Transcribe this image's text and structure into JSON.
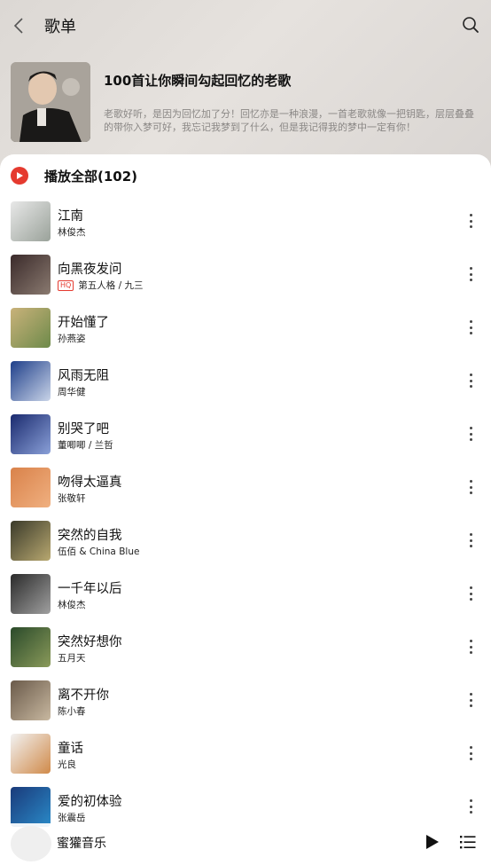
{
  "header": {
    "title": "歌单",
    "back_icon": "chevron-left-icon",
    "search_icon": "search-icon"
  },
  "playlist": {
    "name": "100首让你瞬间勾起回忆的老歌",
    "description": "老歌好听，是因为回忆加了分！回忆亦是一种浪漫，一首老歌就像一把钥匙，层层叠叠的带你入梦可好，我忘记我梦到了什么，但是我记得我的梦中一定有你！"
  },
  "play_all": {
    "label": "播放全部(102)",
    "icon": "play-circle-icon",
    "accent": "#e53a2f"
  },
  "songs": [
    {
      "title": "江南",
      "artist": "林俊杰",
      "hq": false,
      "cover": [
        "#e8e8e8",
        "#9aa29a"
      ]
    },
    {
      "title": "向黑夜发问",
      "artist": "第五人格 / 九三",
      "hq": true,
      "cover": [
        "#3a2a2a",
        "#8a7a70"
      ]
    },
    {
      "title": "开始懂了",
      "artist": "孙燕姿",
      "hq": false,
      "cover": [
        "#c9b27a",
        "#6e8a4a"
      ]
    },
    {
      "title": "风雨无阻",
      "artist": "周华健",
      "hq": false,
      "cover": [
        "#1f3f8a",
        "#c9d4e8"
      ]
    },
    {
      "title": "别哭了吧",
      "artist": "董唧唧 / 兰哲",
      "hq": false,
      "cover": [
        "#1a2a6e",
        "#8aa0d8"
      ]
    },
    {
      "title": "吻得太逼真",
      "artist": "张敬轩",
      "hq": false,
      "cover": [
        "#d9824a",
        "#f0b080"
      ]
    },
    {
      "title": "突然的自我",
      "artist": "伍佰 & China Blue",
      "hq": false,
      "cover": [
        "#3a3a2a",
        "#b8a870"
      ]
    },
    {
      "title": "一千年以后",
      "artist": "林俊杰",
      "hq": false,
      "cover": [
        "#2a2a2a",
        "#a0a0a0"
      ]
    },
    {
      "title": "突然好想你",
      "artist": "五月天",
      "hq": false,
      "cover": [
        "#2a4a2a",
        "#8a9a5a"
      ]
    },
    {
      "title": "离不开你",
      "artist": "陈小春",
      "hq": false,
      "cover": [
        "#6a5a4a",
        "#c8b8a0"
      ]
    },
    {
      "title": "童话",
      "artist": "光良",
      "hq": false,
      "cover": [
        "#f2f2f2",
        "#d08a4a"
      ]
    },
    {
      "title": "爱的初体验",
      "artist": "张震岳",
      "hq": false,
      "cover": [
        "#1a3a7a",
        "#2a8ac8"
      ]
    }
  ],
  "mini_player": {
    "title": "蜜獾音乐",
    "play_icon": "play-icon",
    "playlist_icon": "playlist-icon"
  }
}
